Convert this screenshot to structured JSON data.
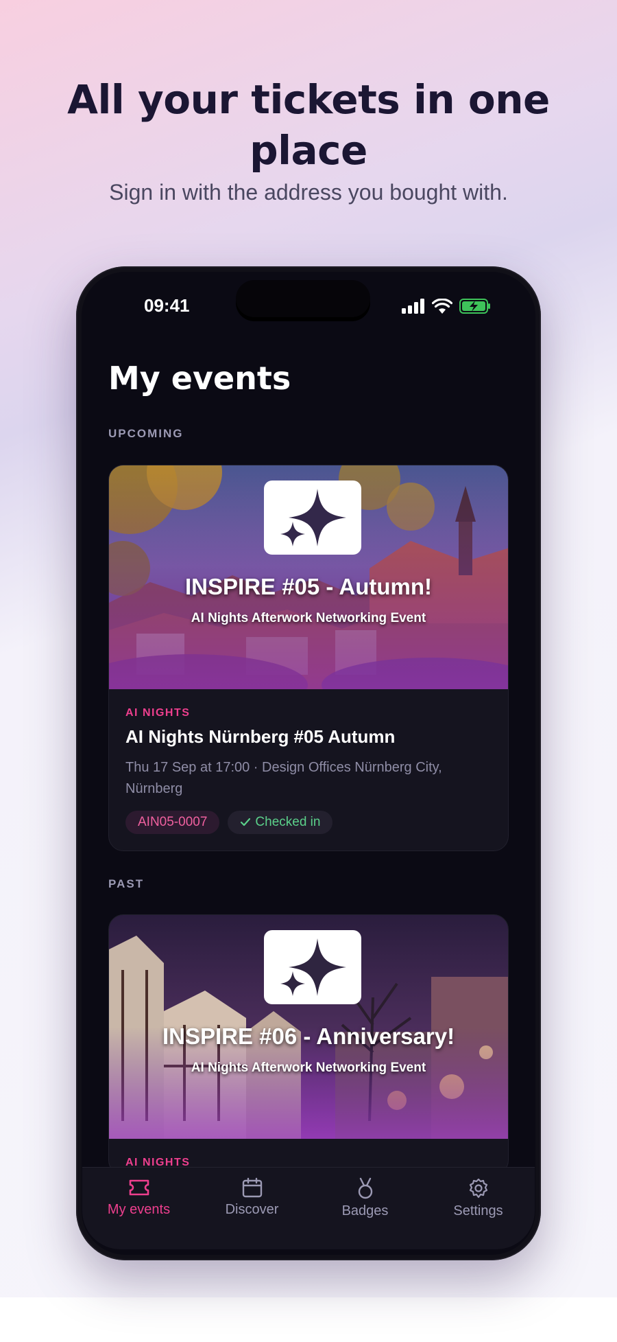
{
  "promo": {
    "headline_line1": "All your tickets in one",
    "headline_line2": "place",
    "subline": "Sign in with the address you bought with."
  },
  "status_bar": {
    "time": "09:41"
  },
  "screen": {
    "title": "My events",
    "upcoming_label": "UPCOMING",
    "past_label": "PAST"
  },
  "upcoming_event": {
    "banner_title": "INSPIRE #05 - Autumn!",
    "banner_subtitle": "AI Nights Afterwork Networking Event",
    "organizer": "AI NIGHTS",
    "name": "AI Nights Nürnberg #05 Autumn",
    "meta": "Thu 17 Sep at 17:00 · Design Offices Nürnberg City, Nürnberg",
    "ticket_code": "AIN05-0007",
    "status": "Checked in"
  },
  "past_event": {
    "banner_title": "INSPIRE #06 - Anniversary!",
    "banner_subtitle": "AI Nights Afterwork Networking Event",
    "organizer": "AI NIGHTS"
  },
  "tabs": [
    {
      "label": "My events",
      "icon": "ticket-icon",
      "active": true
    },
    {
      "label": "Discover",
      "icon": "calendar-icon",
      "active": false
    },
    {
      "label": "Badges",
      "icon": "medal-icon",
      "active": false
    },
    {
      "label": "Settings",
      "icon": "gear-icon",
      "active": false
    }
  ],
  "colors": {
    "accent": "#ee3f8e",
    "success": "#5bd08a",
    "screen_bg": "#0b0a14",
    "card_bg": "#15141f"
  }
}
